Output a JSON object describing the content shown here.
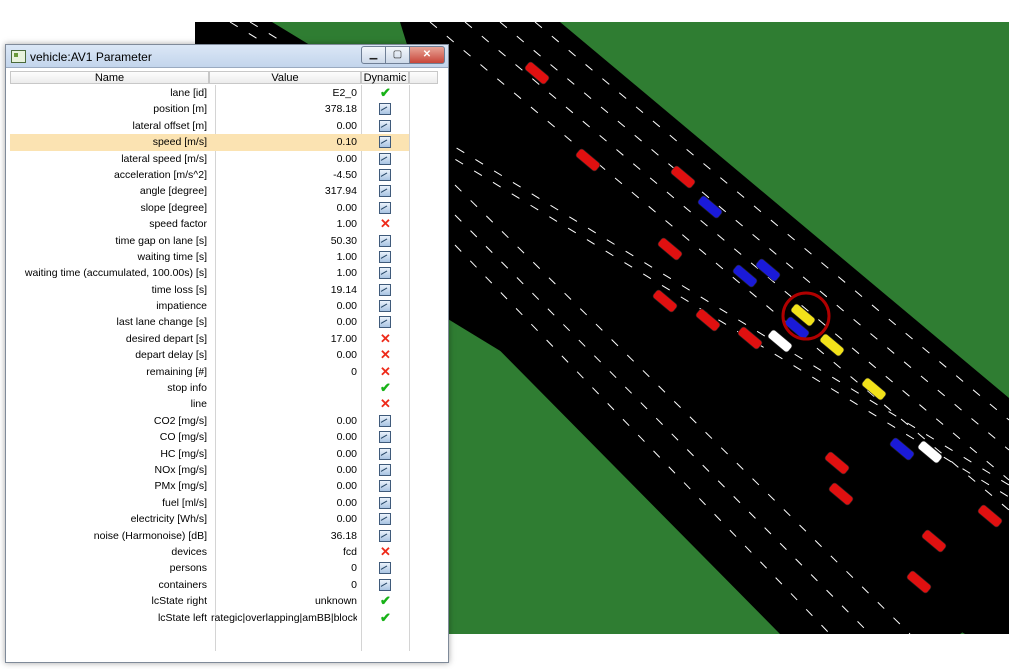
{
  "window": {
    "title": "vehicle:AV1 Parameter",
    "buttons": {
      "minimize": "▁",
      "maximize": "▢",
      "close": "✕"
    }
  },
  "table": {
    "columns": {
      "name": "Name",
      "value": "Value",
      "dynamic": "Dynamic"
    },
    "selected_row": 3,
    "rows": [
      {
        "name": "lane [id]",
        "value": "E2_0",
        "dyn": "check"
      },
      {
        "name": "position [m]",
        "value": "378.18",
        "dyn": "plot"
      },
      {
        "name": "lateral offset [m]",
        "value": "0.00",
        "dyn": "plot"
      },
      {
        "name": "speed [m/s]",
        "value": "0.10",
        "dyn": "plot"
      },
      {
        "name": "lateral speed [m/s]",
        "value": "0.00",
        "dyn": "plot"
      },
      {
        "name": "acceleration [m/s^2]",
        "value": "-4.50",
        "dyn": "plot"
      },
      {
        "name": "angle [degree]",
        "value": "317.94",
        "dyn": "plot"
      },
      {
        "name": "slope [degree]",
        "value": "0.00",
        "dyn": "plot"
      },
      {
        "name": "speed factor",
        "value": "1.00",
        "dyn": "cross"
      },
      {
        "name": "time gap on lane [s]",
        "value": "50.30",
        "dyn": "plot"
      },
      {
        "name": "waiting time [s]",
        "value": "1.00",
        "dyn": "plot"
      },
      {
        "name": "waiting time (accumulated, 100.00s) [s]",
        "value": "1.00",
        "dyn": "plot"
      },
      {
        "name": "time loss [s]",
        "value": "19.14",
        "dyn": "plot"
      },
      {
        "name": "impatience",
        "value": "0.00",
        "dyn": "plot"
      },
      {
        "name": "last lane change [s]",
        "value": "0.00",
        "dyn": "plot"
      },
      {
        "name": "desired depart [s]",
        "value": "17.00",
        "dyn": "cross"
      },
      {
        "name": "depart delay [s]",
        "value": "0.00",
        "dyn": "cross"
      },
      {
        "name": "remaining [#]",
        "value": "0",
        "dyn": "cross"
      },
      {
        "name": "stop info",
        "value": "",
        "dyn": "check"
      },
      {
        "name": "line",
        "value": "",
        "dyn": "cross"
      },
      {
        "name": "CO2 [mg/s]",
        "value": "0.00",
        "dyn": "plot"
      },
      {
        "name": "CO [mg/s]",
        "value": "0.00",
        "dyn": "plot"
      },
      {
        "name": "HC [mg/s]",
        "value": "0.00",
        "dyn": "plot"
      },
      {
        "name": "NOx [mg/s]",
        "value": "0.00",
        "dyn": "plot"
      },
      {
        "name": "PMx [mg/s]",
        "value": "0.00",
        "dyn": "plot"
      },
      {
        "name": "fuel [ml/s]",
        "value": "0.00",
        "dyn": "plot"
      },
      {
        "name": "electricity [Wh/s]",
        "value": "0.00",
        "dyn": "plot"
      },
      {
        "name": "noise (Harmonoise) [dB]",
        "value": "36.18",
        "dyn": "plot"
      },
      {
        "name": "devices",
        "value": "fcd",
        "dyn": "cross"
      },
      {
        "name": "persons",
        "value": "0",
        "dyn": "plot"
      },
      {
        "name": "containers",
        "value": "0",
        "dyn": "plot"
      },
      {
        "name": "lcState right",
        "value": "unknown",
        "dyn": "check"
      },
      {
        "name": "lcState left",
        "value": "rategic|overlapping|amBB|blocked",
        "dyn": "check"
      },
      {
        "name": "",
        "value": "",
        "dyn": ""
      }
    ]
  },
  "simulation": {
    "colors": {
      "grass": "#2f7d32",
      "road": "#000000",
      "lane_marks": "#ffffff",
      "highlight": "#b00000"
    },
    "vehicle_colors": {
      "red": "#e01010",
      "blue": "#1a1ad8",
      "yellow": "#f2e21a",
      "white": "#ffffff"
    }
  }
}
